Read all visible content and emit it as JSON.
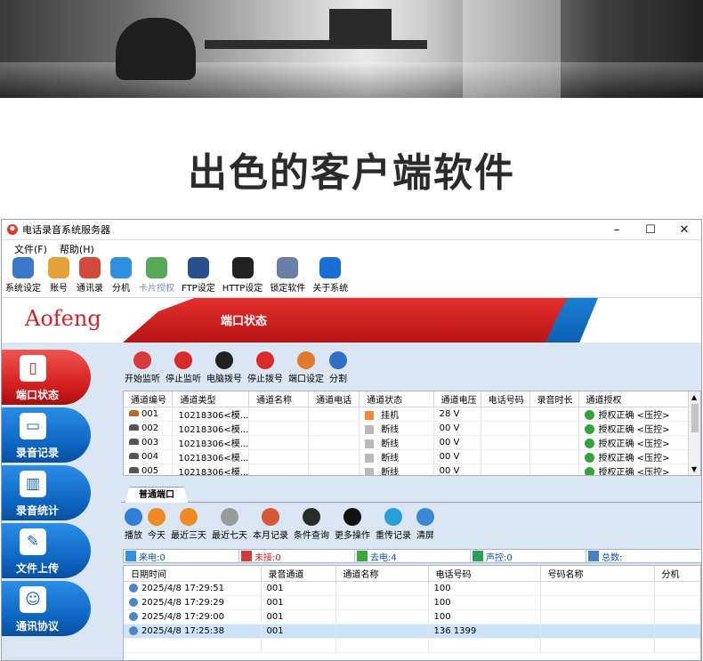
{
  "headline": "出色的客户端软件",
  "window": {
    "title": "电话录音系统服务器",
    "controls": {
      "minimize": "–",
      "maximize": "☐",
      "close": "✕"
    }
  },
  "menu": [
    "文件(F)",
    "帮助(H)"
  ],
  "toolbar": [
    {
      "label": "系统设定",
      "icon": "gear-icon",
      "color": "#3a78c8"
    },
    {
      "label": "账号",
      "icon": "user-key-icon",
      "color": "#e3a33a"
    },
    {
      "label": "通讯录",
      "icon": "notebook-icon",
      "color": "#d44a3a"
    },
    {
      "label": "分机",
      "icon": "group-icon",
      "color": "#2f8fe0"
    },
    {
      "label": "卡片授权",
      "icon": "card-icon",
      "color": "#58a858"
    },
    {
      "label": "FTP设定",
      "icon": "ftp-icon",
      "color": "#2a4f8f"
    },
    {
      "label": "HTTP设定",
      "icon": "http-icon",
      "color": "#222222"
    },
    {
      "label": "锁定软件",
      "icon": "lock-icon",
      "color": "#6a7fa8"
    },
    {
      "label": "关于系统",
      "icon": "info-icon",
      "color": "#1a6fd6"
    }
  ],
  "banner": {
    "brand": "Aofeng",
    "title": "端口状态"
  },
  "nav": [
    {
      "label": "端口状态",
      "icon": "port-icon",
      "active": true
    },
    {
      "label": "录音记录",
      "icon": "cassette-icon",
      "active": false
    },
    {
      "label": "录音统计",
      "icon": "bar-chart-icon",
      "active": false
    },
    {
      "label": "文件上传",
      "icon": "wrench-icon",
      "active": false
    },
    {
      "label": "通讯协议",
      "icon": "people-icon",
      "active": false
    }
  ],
  "actions": [
    {
      "label": "开始监听",
      "icon": "camera-icon",
      "color": "#d93a3a"
    },
    {
      "label": "停止监听",
      "icon": "pause-icon",
      "color": "#d92b2b"
    },
    {
      "label": "电脑拨号",
      "icon": "telephone-icon",
      "color": "#222222"
    },
    {
      "label": "停止拨号",
      "icon": "stop-icon",
      "color": "#d92b2b"
    },
    {
      "label": "端口设定",
      "icon": "pencil-icon",
      "color": "#e07a2a"
    },
    {
      "label": "分割",
      "icon": "split-icon",
      "color": "#2f6fc6"
    }
  ],
  "port_table": {
    "columns": [
      "通道编号",
      "通道类型",
      "通道名称",
      "通道电话",
      "通道状态",
      "通道电压",
      "电话号码",
      "录音时长",
      "通道授权"
    ],
    "rows": [
      {
        "id": "001",
        "type": "10218306<模...",
        "name": "",
        "phone": "",
        "status": "挂机",
        "voltage": "28 V",
        "number": "",
        "duration": "",
        "auth": "授权正确 <压控>",
        "active": true
      },
      {
        "id": "002",
        "type": "10218306<模...",
        "name": "",
        "phone": "",
        "status": "断线",
        "voltage": "00 V",
        "number": "",
        "duration": "",
        "auth": "授权正确 <压控>",
        "active": false
      },
      {
        "id": "003",
        "type": "10218306<模...",
        "name": "",
        "phone": "",
        "status": "断线",
        "voltage": "00 V",
        "number": "",
        "duration": "",
        "auth": "授权正确 <压控>",
        "active": false
      },
      {
        "id": "004",
        "type": "10218306<模...",
        "name": "",
        "phone": "",
        "status": "断线",
        "voltage": "00 V",
        "number": "",
        "duration": "",
        "auth": "授权正确 <压控>",
        "active": false
      },
      {
        "id": "005",
        "type": "10218306<模...",
        "name": "",
        "phone": "",
        "status": "断线",
        "voltage": "00 V",
        "number": "",
        "duration": "",
        "auth": "授权正确 <压控>",
        "active": false
      }
    ]
  },
  "tab": {
    "label": "普通端口"
  },
  "record_actions": [
    {
      "label": "播放",
      "icon": "play-icon",
      "color": "#2f7fd6"
    },
    {
      "label": "今天",
      "icon": "calendar-today-icon",
      "color": "#f08a24"
    },
    {
      "label": "最近三天",
      "icon": "calendar-3-icon",
      "color": "#f08a24"
    },
    {
      "label": "最近七天",
      "icon": "calendar-7-icon",
      "color": "#9a9a9a"
    },
    {
      "label": "本月记录",
      "icon": "calendar-30-icon",
      "color": "#d55a3a"
    },
    {
      "label": "条件查询",
      "icon": "magnifier-icon",
      "color": "#2b2b2b"
    },
    {
      "label": "更多操作",
      "icon": "more-icon",
      "color": "#111111"
    },
    {
      "label": "重传记录",
      "icon": "refresh-icon",
      "color": "#2aa0d8"
    },
    {
      "label": "清屏",
      "icon": "broom-icon",
      "color": "#3a88d6"
    }
  ],
  "stats": [
    {
      "label": "来电:0",
      "icon": "incoming-icon",
      "color": "#2f8fe0",
      "text_color": "#0a55b0"
    },
    {
      "label": "未接:0",
      "icon": "missed-icon",
      "color": "#d63a3a",
      "text_color": "#d41a1a"
    },
    {
      "label": "去电:4",
      "icon": "outgoing-icon",
      "color": "#3aa83a",
      "text_color": "#0a55b0"
    },
    {
      "label": "声控:0",
      "icon": "voice-icon",
      "color": "#2aa05a",
      "text_color": "#0a55b0"
    },
    {
      "label": "总数:",
      "icon": "total-icon",
      "color": "#4a7fc6",
      "text_color": "#0a55b0"
    }
  ],
  "record_table": {
    "columns": [
      "日期时间",
      "录音通道",
      "通道名称",
      "电话号码",
      "号码名称",
      "分机"
    ],
    "rows": [
      {
        "datetime": "2025/4/8 17:29:51",
        "channel": "001",
        "name": "",
        "number": "100",
        "number_name": "",
        "ext": "",
        "selected": false
      },
      {
        "datetime": "2025/4/8 17:29:29",
        "channel": "001",
        "name": "",
        "number": "100",
        "number_name": "",
        "ext": "",
        "selected": false
      },
      {
        "datetime": "2025/4/8 17:29:00",
        "channel": "001",
        "name": "",
        "number": "100",
        "number_name": "",
        "ext": "",
        "selected": false
      },
      {
        "datetime": "2025/4/8 17:25:38",
        "channel": "001",
        "name": "",
        "number": "136    1399",
        "number_name": "",
        "ext": "",
        "selected": true
      }
    ]
  }
}
